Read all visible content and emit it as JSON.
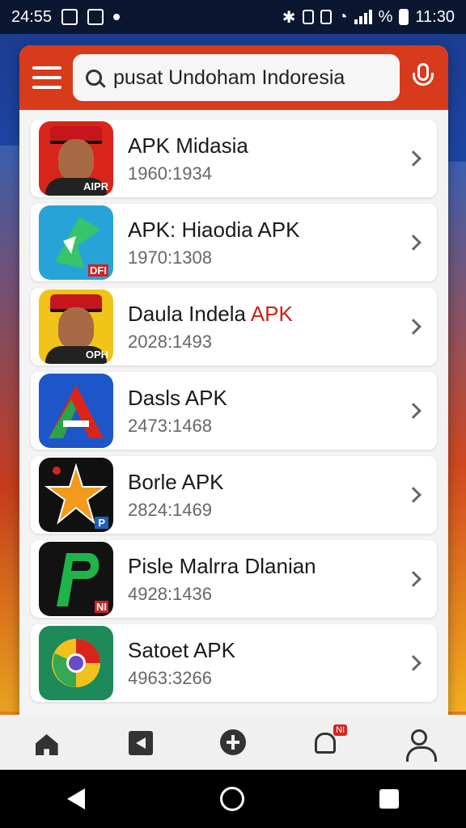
{
  "status_bar": {
    "time_left": "24:55",
    "time_right": "11:30",
    "battery_label": "%"
  },
  "search": {
    "value": "pusat Undoham Indoresia"
  },
  "apps": [
    {
      "title": "APK Midasia",
      "title_highlight": "",
      "subtitle": "1960:1934",
      "icon_label": "AIPR"
    },
    {
      "title": "APK: Hiaodia APK",
      "title_highlight": "",
      "subtitle": "1970:1308",
      "icon_label": "DFI"
    },
    {
      "title": "Daula Indela ",
      "title_highlight": "APK",
      "subtitle": "2028:1493",
      "icon_label": "OPH"
    },
    {
      "title": "Dasls APK",
      "title_highlight": "",
      "subtitle": "2473:1468",
      "icon_label": ""
    },
    {
      "title": "Borle APK",
      "title_highlight": "",
      "subtitle": "2824:1469",
      "icon_label": "P"
    },
    {
      "title": "Pisle Malrra Dlanian",
      "title_highlight": "",
      "subtitle": "4928:1436",
      "icon_label": "NI"
    },
    {
      "title": "Satoet APK",
      "title_highlight": "",
      "subtitle": "4963:3266",
      "icon_label": ""
    }
  ],
  "bottom_nav": {
    "notification_badge": "NI"
  },
  "colors": {
    "accent": "#d83a1c",
    "highlight": "#c8231a"
  }
}
